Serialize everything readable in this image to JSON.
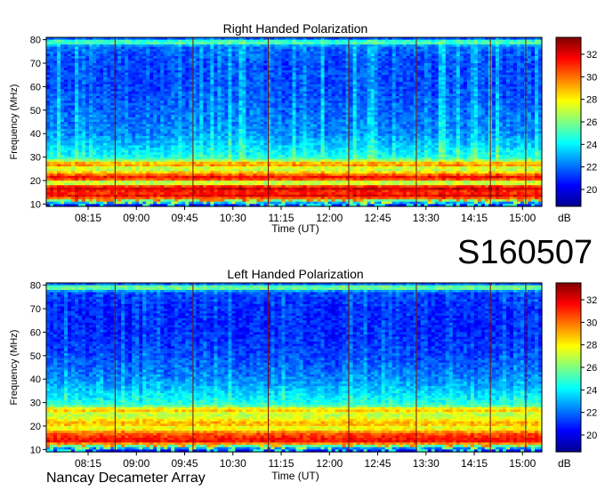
{
  "observation_id": "S160507",
  "instrument": "Nancay Decameter Array",
  "colors": {
    "colormap": [
      "#00008f",
      "#0000ff",
      "#0080ff",
      "#00ffff",
      "#80ff80",
      "#ffff00",
      "#ff8000",
      "#ff0000",
      "#800000"
    ],
    "event_line": "#7a0a0a"
  },
  "chart_data": [
    {
      "type": "heatmap",
      "title": "Right Handed Polarization",
      "xlabel": "Time (UT)",
      "ylabel": "Frequency (MHz)",
      "xticks": [
        "08:15",
        "09:00",
        "09:45",
        "10:30",
        "11:15",
        "12:00",
        "12:45",
        "13:30",
        "14:15",
        "15:00"
      ],
      "xrange_hours": [
        7.6,
        15.3
      ],
      "yticks": [
        10,
        20,
        30,
        40,
        50,
        60,
        70,
        80
      ],
      "ylim": [
        9,
        81
      ],
      "colorbar": {
        "label": "dB",
        "ticks": [
          20,
          22,
          24,
          26,
          28,
          30,
          32
        ],
        "range": [
          18.5,
          33.5
        ]
      },
      "event_markers_hours": [
        8.67,
        9.88,
        11.05,
        12.3,
        13.35,
        14.5,
        15.05
      ],
      "frequency_profile_db": [
        {
          "f": 9,
          "db": 19.5
        },
        {
          "f": 11,
          "db": 23.5
        },
        {
          "f": 13,
          "db": 32
        },
        {
          "f": 15,
          "db": 30.5
        },
        {
          "f": 17,
          "db": 32.5
        },
        {
          "f": 19,
          "db": 25
        },
        {
          "f": 21,
          "db": 32
        },
        {
          "f": 23,
          "db": 29
        },
        {
          "f": 25,
          "db": 26
        },
        {
          "f": 27,
          "db": 30
        },
        {
          "f": 28,
          "db": 27
        },
        {
          "f": 30,
          "db": 24
        },
        {
          "f": 35,
          "db": 23
        },
        {
          "f": 40,
          "db": 22
        },
        {
          "f": 50,
          "db": 21.5
        },
        {
          "f": 60,
          "db": 21
        },
        {
          "f": 70,
          "db": 21
        },
        {
          "f": 77,
          "db": 21.5
        },
        {
          "f": 79,
          "db": 26
        },
        {
          "f": 81,
          "db": 20
        }
      ],
      "burst_activity": 0.75
    },
    {
      "type": "heatmap",
      "title": "Left Handed Polarization",
      "xlabel": "Time (UT)",
      "ylabel": "Frequency (MHz)",
      "xticks": [
        "08:15",
        "09:00",
        "09:45",
        "10:30",
        "11:15",
        "12:00",
        "12:45",
        "13:30",
        "14:15",
        "15:00"
      ],
      "xrange_hours": [
        7.6,
        15.3
      ],
      "yticks": [
        10,
        20,
        30,
        40,
        50,
        60,
        70,
        80
      ],
      "ylim": [
        9,
        81
      ],
      "colorbar": {
        "label": "dB",
        "ticks": [
          20,
          22,
          24,
          26,
          28,
          30,
          32
        ],
        "range": [
          18.5,
          33.5
        ]
      },
      "event_markers_hours": [
        8.67,
        9.88,
        11.05,
        12.3,
        13.35,
        14.5,
        15.05
      ],
      "frequency_profile_db": [
        {
          "f": 9,
          "db": 19.5
        },
        {
          "f": 11,
          "db": 23
        },
        {
          "f": 13,
          "db": 31.5
        },
        {
          "f": 15,
          "db": 31
        },
        {
          "f": 17,
          "db": 30
        },
        {
          "f": 19,
          "db": 27
        },
        {
          "f": 21,
          "db": 29
        },
        {
          "f": 23,
          "db": 27.5
        },
        {
          "f": 25,
          "db": 26.5
        },
        {
          "f": 27,
          "db": 29
        },
        {
          "f": 28,
          "db": 26
        },
        {
          "f": 30,
          "db": 24
        },
        {
          "f": 35,
          "db": 23
        },
        {
          "f": 40,
          "db": 22
        },
        {
          "f": 50,
          "db": 21
        },
        {
          "f": 60,
          "db": 20.5
        },
        {
          "f": 70,
          "db": 20.5
        },
        {
          "f": 77,
          "db": 21
        },
        {
          "f": 79,
          "db": 27
        },
        {
          "f": 81,
          "db": 20
        }
      ],
      "burst_activity": 0.45
    }
  ]
}
